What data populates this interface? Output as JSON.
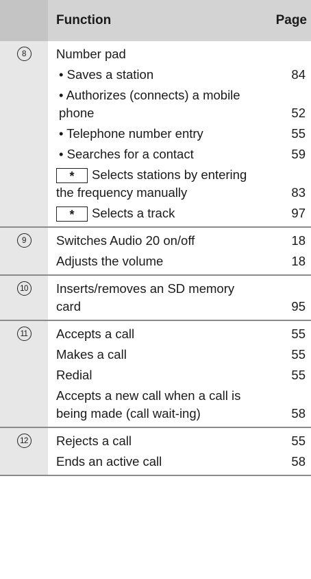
{
  "header": {
    "function": "Function",
    "page": "Page"
  },
  "key_symbol": "*",
  "sections": [
    {
      "num": "8",
      "rows": [
        {
          "text": "Number pad",
          "page": ""
        },
        {
          "text": "• Saves a station",
          "page": "84"
        },
        {
          "text": "• Authorizes (connects) a mobile phone",
          "page": "52"
        },
        {
          "text": "• Telephone number entry",
          "page": "55"
        },
        {
          "text": "• Searches for a contact",
          "page": "59"
        },
        {
          "text": "Selects stations by entering the frequency manually",
          "page": "83"
        },
        {
          "text": "Selects a track",
          "page": "97"
        }
      ]
    },
    {
      "num": "9",
      "rows": [
        {
          "text": "Switches Audio 20 on/off",
          "page": "18"
        },
        {
          "text": "Adjusts the volume",
          "page": "18"
        }
      ]
    },
    {
      "num": "10",
      "rows": [
        {
          "text": "Inserts/removes an SD memory card",
          "page": "95"
        }
      ]
    },
    {
      "num": "11",
      "rows": [
        {
          "text": "Accepts a call",
          "page": "55"
        },
        {
          "text": "Makes a call",
          "page": "55"
        },
        {
          "text": "Redial",
          "page": "55"
        },
        {
          "text": "Accepts a new call when a call is being made (call wait-ing)",
          "page": "58"
        }
      ]
    },
    {
      "num": "12",
      "rows": [
        {
          "text": "Rejects a call",
          "page": "55"
        },
        {
          "text": "Ends an active call",
          "page": "58"
        }
      ]
    }
  ]
}
